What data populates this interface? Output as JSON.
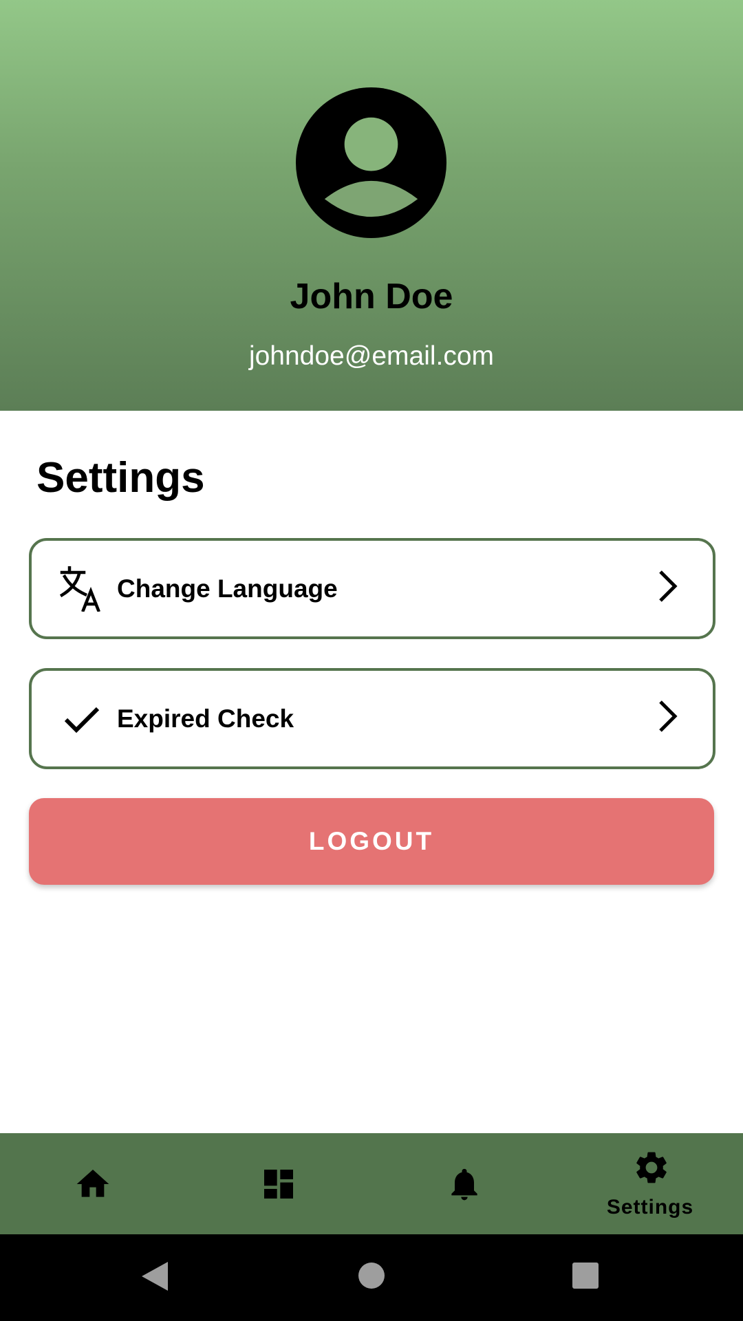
{
  "profile": {
    "name": "John Doe",
    "email": "johndoe@email.com",
    "avatar_icon": "account-circle-icon"
  },
  "settings": {
    "title": "Settings",
    "items": [
      {
        "label": "Change Language",
        "icon": "translate-icon",
        "trailing_icon": "chevron-right-icon"
      },
      {
        "label": "Expired Check",
        "icon": "check-icon",
        "trailing_icon": "chevron-right-icon"
      }
    ],
    "logout_label": "LOGOUT"
  },
  "bottom_nav": {
    "items": [
      {
        "icon": "home-icon",
        "label": "",
        "selected": false
      },
      {
        "icon": "dashboard-icon",
        "label": "",
        "selected": false
      },
      {
        "icon": "bell-icon",
        "label": "",
        "selected": false
      },
      {
        "icon": "gear-icon",
        "label": "Settings",
        "selected": true
      }
    ]
  },
  "system_nav": {
    "buttons": [
      "back-icon",
      "home-circle-icon",
      "recents-icon"
    ]
  },
  "colors": {
    "header_gradient_top": "#93c788",
    "header_gradient_bottom": "#5c7e56",
    "card_border": "#56754e",
    "logout_background": "#e57373",
    "bottom_nav_background": "#53754d",
    "system_nav_background": "#000000",
    "system_nav_buttons": "#9e9e9e"
  }
}
